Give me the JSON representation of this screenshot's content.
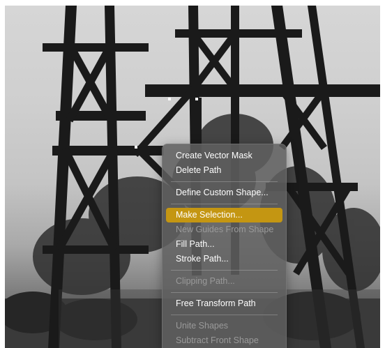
{
  "context_menu": {
    "items": [
      {
        "label": "Create Vector Mask",
        "enabled": true
      },
      {
        "label": "Delete Path",
        "enabled": true
      },
      {
        "label": "Define Custom Shape...",
        "enabled": true
      },
      {
        "label": "Make Selection...",
        "enabled": true,
        "highlighted": true
      },
      {
        "label": "New Guides From Shape",
        "enabled": false
      },
      {
        "label": "Fill Path...",
        "enabled": true
      },
      {
        "label": "Stroke Path...",
        "enabled": true
      },
      {
        "label": "Clipping Path...",
        "enabled": false
      },
      {
        "label": "Free Transform Path",
        "enabled": true
      },
      {
        "label": "Unite Shapes",
        "enabled": false
      },
      {
        "label": "Subtract Front Shape",
        "enabled": false
      }
    ],
    "highlight_color": "#c49612"
  }
}
